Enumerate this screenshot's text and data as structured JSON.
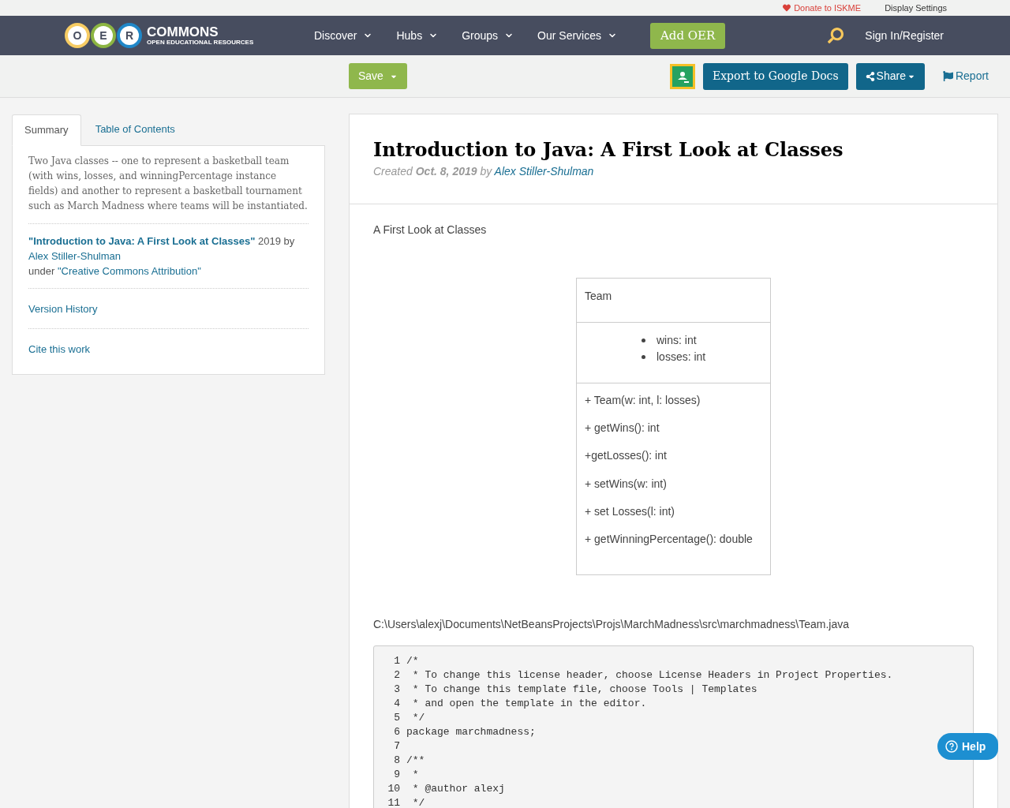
{
  "utility_bar": {
    "donate": "Donate to ISKME",
    "display_settings": "Display Settings"
  },
  "nav": {
    "logo": {
      "letters": [
        "O",
        "E",
        "R"
      ],
      "name": "COMMONS",
      "tagline": "OPEN EDUCATIONAL RESOURCES"
    },
    "menus": [
      {
        "label": "Discover"
      },
      {
        "label": "Hubs"
      },
      {
        "label": "Groups"
      },
      {
        "label": "Our Services"
      }
    ],
    "add_button": "Add OER",
    "sign_in": "Sign In/Register"
  },
  "toolbar": {
    "save": "Save",
    "export": "Export to Google Docs",
    "share": "Share",
    "report": "Report"
  },
  "sidebar": {
    "tabs": [
      {
        "label": "Summary",
        "selected": true
      },
      {
        "label": "Table of Contents",
        "selected": false
      }
    ],
    "summary": "Two Java classes -- one to represent a basketball team (with wins, losses, and winningPercentage instance fields) and another to represent a basketball tournament such as March Madness where teams will be instantiated.",
    "attribution": {
      "title": "\"Introduction to Java: A First Look at Classes\"",
      "year_by": "2019 by",
      "author": "Alex Stiller-Shulman",
      "under": "under",
      "license": "\"Creative Commons Attribution\""
    },
    "links": [
      "Version History",
      "Cite this work"
    ]
  },
  "article": {
    "title": "Introduction to Java: A First Look at Classes",
    "meta": {
      "created": "Created",
      "date": "Oct. 8, 2019",
      "by": "by",
      "author": "Alex Stiller-Shulman"
    },
    "subtitle": "A First Look at Classes",
    "uml": {
      "name": "Team",
      "fields": [
        "wins: int",
        "losses: int"
      ],
      "methods": [
        "+ Team(w: int, l: losses)",
        "+ getWins(): int",
        "+getLosses(): int",
        "+ setWins(w: int)",
        "+ set Losses(l: int)",
        "+ getWinningPercentage(): double"
      ]
    },
    "path": "C:\\Users\\alexj\\Documents\\NetBeansProjects\\Projs\\MarchMadness\\src\\marchmadness\\Team.java",
    "code": [
      {
        "number": "1",
        "text": "/*"
      },
      {
        "number": "2",
        "text": " * To change this license header, choose License Headers in Project Properties."
      },
      {
        "number": "3",
        "text": " * To change this template file, choose Tools | Templates"
      },
      {
        "number": "4",
        "text": " * and open the template in the editor."
      },
      {
        "number": "5",
        "text": " */"
      },
      {
        "number": "6",
        "text": "package marchmadness;"
      },
      {
        "number": "7"
      },
      {
        "number": "8",
        "text": "/**"
      },
      {
        "number": "9",
        "text": " *"
      },
      {
        "number": "10",
        "text": " * @author alexj"
      },
      {
        "number": "11",
        "text": " */"
      }
    ]
  },
  "help": "Help"
}
